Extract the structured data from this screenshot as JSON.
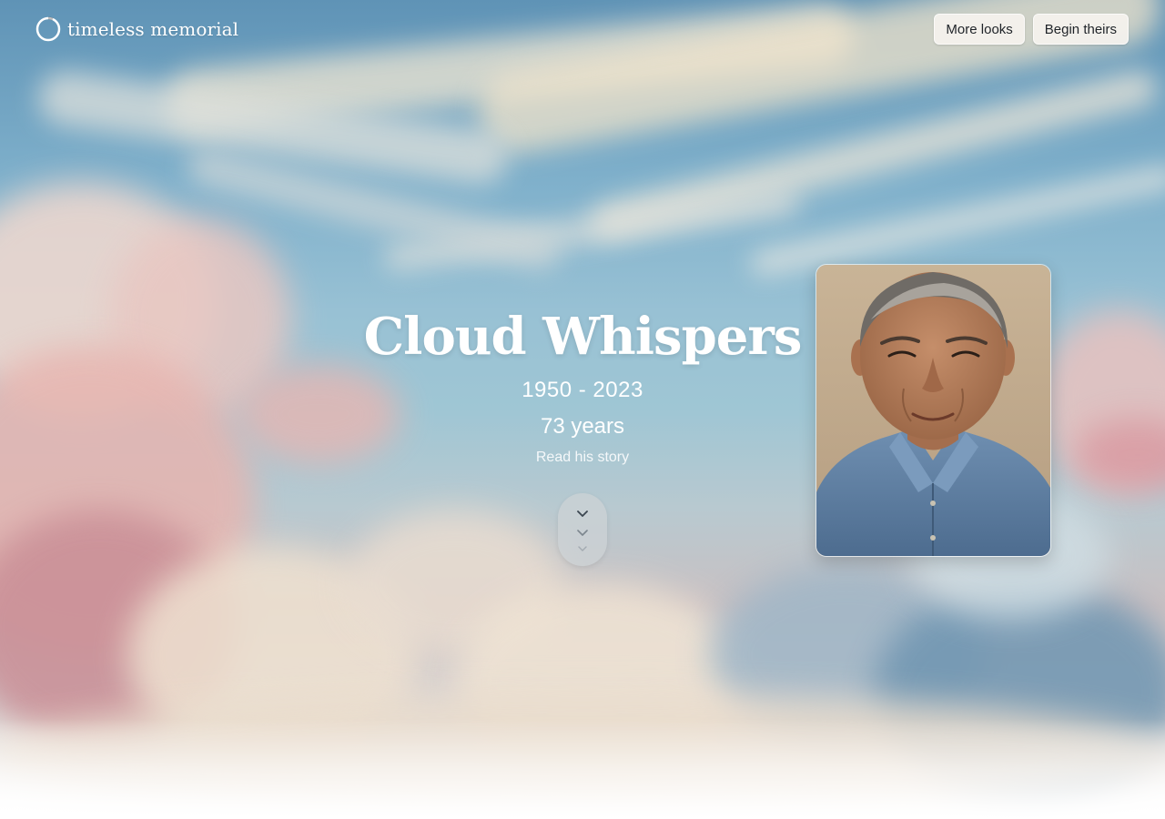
{
  "brand": {
    "name": "timeless memorial",
    "logo_icon": "ring-logo-icon"
  },
  "header": {
    "more_looks_label": "More looks",
    "begin_theirs_label": "Begin theirs"
  },
  "memorial": {
    "name": "Cloud Whispers",
    "dates": "1950 - 2023",
    "age": "73 years",
    "read_story_label": "Read his story"
  },
  "scroll_indicator": {
    "icon": "chevron-down-icon"
  },
  "portrait": {
    "icon": "portrait-photo"
  },
  "colors": {
    "sky_top": "#5f93b6",
    "sky_mid": "#9fc6d4",
    "cloud_cream": "#f3e6cf",
    "cloud_pink": "#d8a0a4",
    "button_bg": "#f5f2ee",
    "button_text": "#1f2328"
  }
}
